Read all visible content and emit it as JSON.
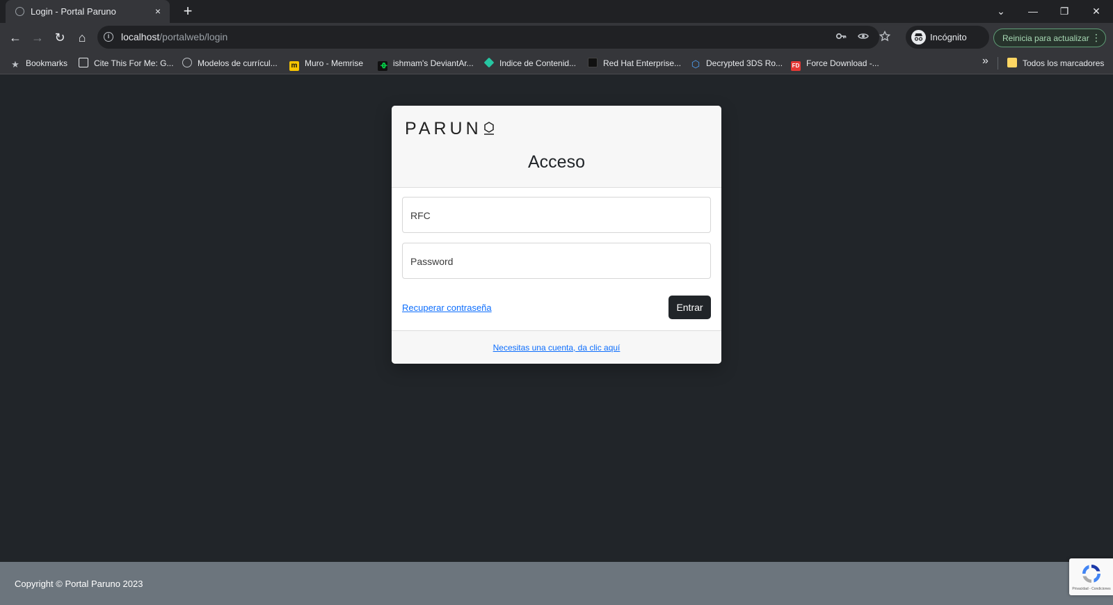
{
  "browser": {
    "tab": {
      "title": "Login - Portal Paruno",
      "close_symbol": "×"
    },
    "new_tab_symbol": "+",
    "window_controls": {
      "tabsearch": "⌄",
      "minimize": "—",
      "restore": "❐",
      "close": "✕"
    },
    "nav": {
      "back": "←",
      "forward": "→",
      "reload": "↻",
      "home": "⌂"
    },
    "address": {
      "host": "localhost",
      "path": "/portalweb/login"
    },
    "omnibox_icons": [
      "key-icon",
      "eye-icon",
      "star-icon"
    ],
    "incognito_label": "Incógnito",
    "update_label": "Reinicia para actualizar",
    "more_symbol": "⋮",
    "bookmarks": [
      {
        "label": "Bookmarks",
        "icon": "star-icon",
        "color": "#bdc1c6"
      },
      {
        "label": "Cite This For Me: G...",
        "icon": "book-icon",
        "color": "#e8eaed"
      },
      {
        "label": "Modelos de currícul...",
        "icon": "globe-icon",
        "color": "#bdc1c6"
      },
      {
        "label": "Muro - Memrise",
        "icon": "memrise-icon",
        "color": "#f8c500"
      },
      {
        "label": "ishmam's DeviantAr...",
        "icon": "deviantart-icon",
        "color": "#05cc47"
      },
      {
        "label": "Indice de Contenid...",
        "icon": "diamond-icon",
        "color": "#26c6a2"
      },
      {
        "label": "Red Hat Enterprise...",
        "icon": "redhat-icon",
        "color": "#111111"
      },
      {
        "label": "Decrypted 3DS Ro...",
        "icon": "hexagon-icon",
        "color": "#4fa3f7"
      },
      {
        "label": "Force Download -...",
        "icon": "fd-icon",
        "color": "#e53935"
      }
    ],
    "bookmarks_overflow": "»",
    "all_bookmarks_label": "Todos los marcadores"
  },
  "login": {
    "logo_text": "PARUN",
    "heading": "Acceso",
    "rfc_placeholder": "RFC",
    "password_placeholder": "Password",
    "recover_link": "Recuperar contraseña",
    "submit_label": "Entrar",
    "signup_link": "Necesitas una cuenta, da clic aquí"
  },
  "footer": {
    "copyright": "Copyright © Portal Paruno 2023",
    "recaptcha_text": "Privacidad - Condiciones"
  },
  "colors": {
    "page_bg": "#212529",
    "footer_bg": "#6c757d",
    "link": "#0d6efd",
    "button": "#212529"
  }
}
